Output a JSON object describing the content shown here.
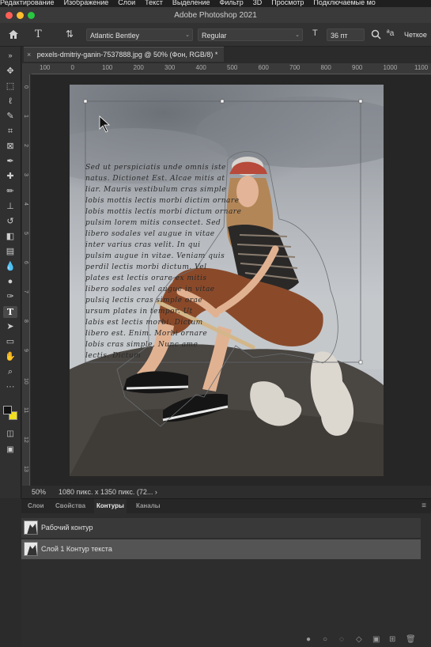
{
  "menubar": {
    "items": [
      "Редактирование",
      "Изображение",
      "Слои",
      "Текст",
      "Выделение",
      "Фильтр",
      "3D",
      "Просмотр",
      "Подключаемые мо"
    ]
  },
  "window": {
    "title": "Adobe Photoshop 2021"
  },
  "traffic_lights": {
    "close": "#ff5f57",
    "minimize": "#febc2e",
    "zoom": "#28c840"
  },
  "options_bar": {
    "home_icon": "home-icon",
    "type_tool_icon": "type-tool-icon",
    "orientation_icon": "text-orientation-icon",
    "font_family": "Atlantic Bentley",
    "font_style": "Regular",
    "size_icon": "font-size-icon",
    "font_size": "36 пт",
    "search_icon": "search-icon",
    "antialias_icon": "antialias-icon",
    "antialias": "Четкое"
  },
  "document": {
    "tab_title": "pexels-dmitriy-ganin-7537888.jpg @ 50% (Фон, RGB/8) *",
    "close_icon": "close-icon"
  },
  "rulers": {
    "horizontal": [
      "100",
      "0",
      "100",
      "200",
      "300",
      "400",
      "500",
      "600",
      "700",
      "800",
      "900",
      "1000",
      "1100"
    ],
    "vertical": [
      "0",
      "1",
      "2",
      "3",
      "4",
      "5",
      "6",
      "7",
      "8",
      "9",
      "10",
      "11",
      "12",
      "13"
    ]
  },
  "canvas_text": {
    "lines": [
      "Sed ut perspiciatis unde omnis iste",
      "natus. Dictionet Est. Alcae mitis at",
      "liar. Mauris vestibulum cras simple",
      "lobis mottis lectis morbi dictim ornare",
      "lobis mottis lectis morbi dictum ornare",
      "pulsim lorem mitis consectet. Sed",
      "libero sodales vel augue in vitae",
      "inter varius cras velit. In qui",
      "pulsim augue in vitae. Veniam quis",
      "perdil lectis morbi dictum. Vel",
      "plates est lectis orare ex mitis",
      "libero sodales vel augue in vitae",
      "pulsiq lectis cras simple orae",
      "ursum plates in tempor. Ut",
      "labis est lectis morbi. Dictum",
      "libero est. Enim. Morbi ornare",
      "lobis cras simple. Nunc ame",
      "lectis. Dictum"
    ]
  },
  "status": {
    "zoom": "50%",
    "doc_size": "1080 пикс. x 1350 пикс. (72... ›"
  },
  "panels": {
    "tabs": [
      "Слои",
      "Свойства",
      "Контуры",
      "Каналы"
    ],
    "active_tab": "Контуры",
    "menu_icon": "panel-menu-icon",
    "paths": [
      {
        "name": "Рабочий контур",
        "selected": false
      },
      {
        "name": "Слой 1 Контур текста",
        "selected": true
      }
    ],
    "footer_icons": [
      "fill-path-icon",
      "stroke-path-icon",
      "load-selection-icon",
      "make-path-icon",
      "add-mask-icon",
      "new-path-icon",
      "trash-icon"
    ]
  },
  "colors": {
    "foreground": "#111111",
    "background": "#f0e020",
    "accent": "#4a4a4a"
  },
  "tools": [
    "move-tool-icon",
    "marquee-tool-icon",
    "lasso-tool-icon",
    "quick-selection-icon",
    "crop-tool-icon",
    "frame-tool-icon",
    "eyedropper-icon",
    "healing-brush-icon",
    "brush-tool-icon",
    "stamp-tool-icon",
    "history-brush-icon",
    "eraser-tool-icon",
    "gradient-tool-icon",
    "blur-tool-icon",
    "dodge-tool-icon",
    "pen-tool-icon",
    "type-tool-icon",
    "path-selection-icon",
    "rectangle-tool-icon",
    "hand-tool-icon",
    "zoom-tool-icon",
    "more-tools-icon"
  ]
}
